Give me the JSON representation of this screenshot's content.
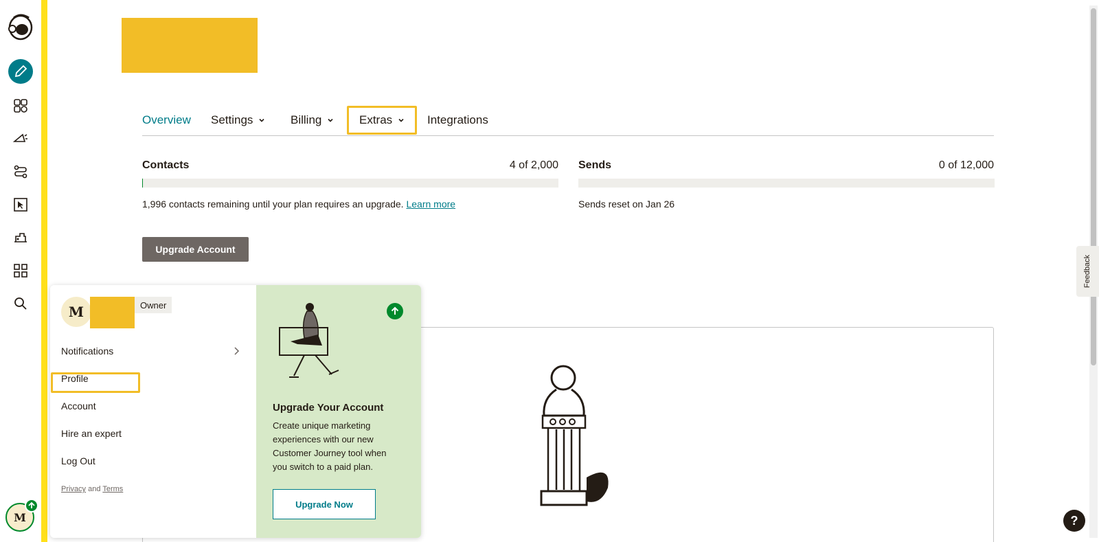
{
  "rail": {
    "icons": [
      "mailchimp-logo-icon",
      "create-pencil-icon",
      "audience-icon",
      "campaigns-megaphone-icon",
      "automations-icon",
      "website-icon",
      "integrations-icon",
      "dashboard-grid-icon",
      "search-icon"
    ],
    "avatar_initial": "M",
    "accent": "#ffe01b"
  },
  "tabs": {
    "overview": "Overview",
    "settings": "Settings",
    "billing": "Billing",
    "extras": "Extras",
    "integrations": "Integrations"
  },
  "usage": {
    "contacts_label": "Contacts",
    "contacts_count": "4 of 2,000",
    "contacts_fill": 0.002,
    "contacts_note": "1,996 contacts remaining until your plan requires an upgrade.",
    "learn_more": "Learn more",
    "sends_label": "Sends",
    "sends_count": "0 of 12,000",
    "sends_fill": 0,
    "sends_note": "Sends reset on Jan 26"
  },
  "upgrade_account_label": "Upgrade Account",
  "account_menu": {
    "avatar_initial": "M",
    "role": "Owner",
    "items": [
      "Notifications",
      "Profile",
      "Account",
      "Hire an expert",
      "Log Out"
    ],
    "privacy": "Privacy",
    "and": "and",
    "terms": "Terms"
  },
  "promo": {
    "title": "Upgrade Your Account",
    "text": "Create unique marketing experiences with our new Customer Journey tool when you switch to a paid plan.",
    "button": "Upgrade Now",
    "background": "#d7e9c8"
  },
  "feedback_label": "Feedback",
  "help_label": "?",
  "colors": {
    "teal": "#007c89",
    "green": "#00892c",
    "highlight": "#f2bd27"
  }
}
